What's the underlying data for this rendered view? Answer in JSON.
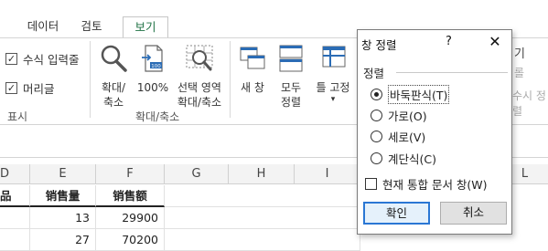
{
  "tabs": [
    {
      "label": "데이터",
      "active": false
    },
    {
      "label": "검토",
      "active": false
    },
    {
      "label": "보기",
      "active": true
    }
  ],
  "ribbon": {
    "show_group": {
      "label": "표시",
      "options": [
        {
          "label": "수식 입력줄",
          "checked": true
        },
        {
          "label": "머리글",
          "checked": true
        }
      ]
    },
    "zoom_group": {
      "label": "확대/축소",
      "buttons": [
        {
          "label_line1": "확대/",
          "label_line2": "축소",
          "icon": "magnifier-icon"
        },
        {
          "label_line1": "100%",
          "label_line2": "",
          "icon": "zoom-100-icon"
        },
        {
          "label_line1": "선택 영역",
          "label_line2": "확대/축소",
          "icon": "zoom-selection-icon"
        }
      ]
    },
    "window_group": {
      "buttons": [
        {
          "label_line1": "새 창",
          "label_line2": "",
          "icon": "new-window-icon"
        },
        {
          "label_line1": "모두",
          "label_line2": "정렬",
          "icon": "arrange-all-icon"
        },
        {
          "label_line1": "틀 고정",
          "label_line2": "",
          "icon": "freeze-panes-icon"
        }
      ],
      "partial_right_top": "기",
      "partial_right_mid": "롤",
      "partial_right_bottom": "수시 정렬"
    }
  },
  "sheet": {
    "columns": [
      "D",
      "E",
      "F",
      "G",
      "H",
      "I",
      "J",
      "K",
      "L"
    ],
    "header_row": [
      "品",
      "销售量",
      "销售额"
    ],
    "rows": [
      [
        "",
        "13",
        "29900"
      ],
      [
        "",
        "27",
        "70200"
      ]
    ]
  },
  "dialog": {
    "title": "창 정렬",
    "help": "?",
    "close": "✕",
    "section_label": "정렬",
    "options": [
      {
        "label": "바둑판식(T)",
        "selected": true
      },
      {
        "label": "가로(O)",
        "selected": false
      },
      {
        "label": "세로(V)",
        "selected": false
      },
      {
        "label": "계단식(C)",
        "selected": false
      }
    ],
    "checkbox_label": "현재 통합 문서 창(W)",
    "ok_label": "확인",
    "cancel_label": "취소"
  },
  "colors": {
    "accent_green": "#1f7244",
    "focus_blue": "#2a77d4",
    "icon_blue": "#2b6cb5"
  }
}
